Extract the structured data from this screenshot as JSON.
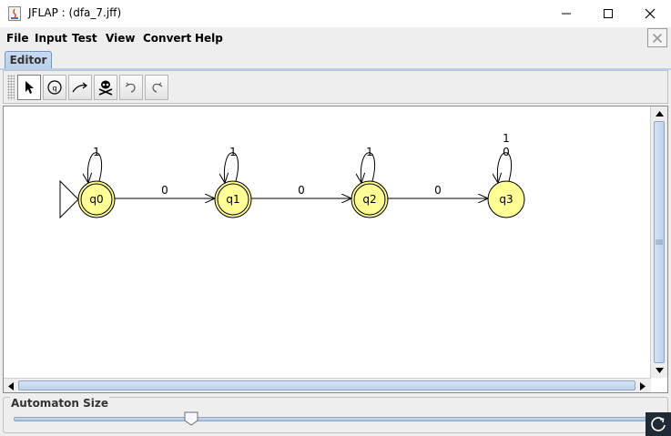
{
  "window": {
    "title": "JFLAP : (dfa_7.jff)"
  },
  "menu": [
    "File",
    "Input",
    "Test",
    "View",
    "Convert",
    "Help"
  ],
  "tabs": [
    {
      "label": "Editor",
      "active": true
    }
  ],
  "toolbar": {
    "tools": [
      "attribute-editor-icon",
      "state-creator-icon",
      "transition-creator-icon",
      "deleter-icon",
      "undo-icon",
      "redo-icon"
    ]
  },
  "automaton": {
    "type": "DFA",
    "initial_state": "q0",
    "states": [
      {
        "id": "q0",
        "label": "q0",
        "final": true
      },
      {
        "id": "q1",
        "label": "q1",
        "final": true
      },
      {
        "id": "q2",
        "label": "q2",
        "final": true
      },
      {
        "id": "q3",
        "label": "q3",
        "final": false
      }
    ],
    "transitions": [
      {
        "from": "q0",
        "to": "q0",
        "label": "1"
      },
      {
        "from": "q0",
        "to": "q1",
        "label": "0"
      },
      {
        "from": "q1",
        "to": "q1",
        "label": "1"
      },
      {
        "from": "q1",
        "to": "q2",
        "label": "0"
      },
      {
        "from": "q2",
        "to": "q2",
        "label": "1"
      },
      {
        "from": "q2",
        "to": "q3",
        "label": "0"
      },
      {
        "from": "q3",
        "to": "q3",
        "label": "1\n0"
      }
    ],
    "colors": {
      "state_fill": "#ffff96",
      "stroke": "#000000"
    }
  },
  "size_panel": {
    "label": "Automaton Size",
    "value_fraction": 0.28
  }
}
